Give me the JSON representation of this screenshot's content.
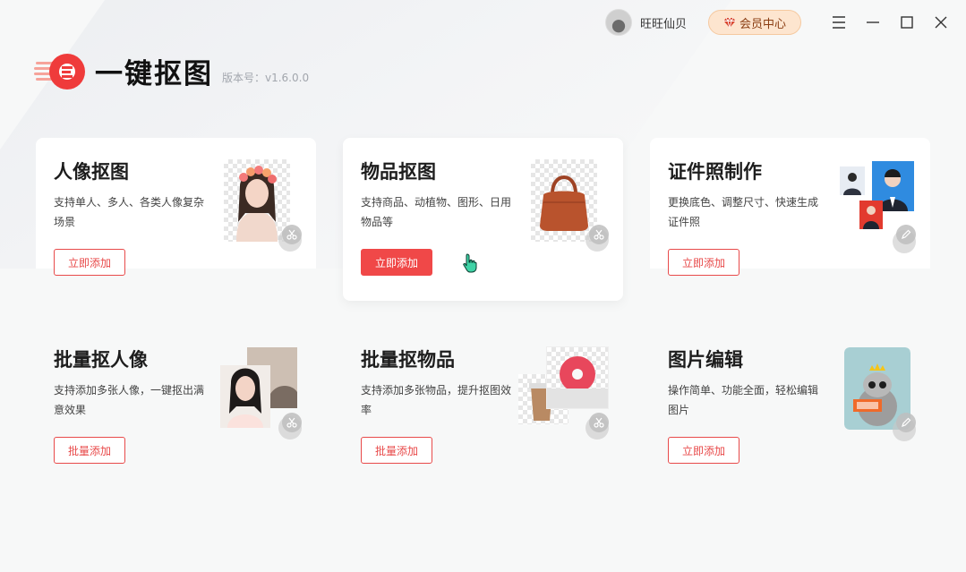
{
  "titlebar": {
    "username": "旺旺仙贝",
    "vip_label": "会员中心"
  },
  "app": {
    "name": "一键抠图",
    "version": "版本号：v1.6.0.0"
  },
  "cards": [
    {
      "title": "人像抠图",
      "desc": "支持单人、多人、各类人像复杂场景",
      "button": "立即添加"
    },
    {
      "title": "物品抠图",
      "desc": "支持商品、动植物、图形、日用物品等",
      "button": "立即添加"
    },
    {
      "title": "证件照制作",
      "desc": "更换底色、调整尺寸、快速生成证件照",
      "button": "立即添加"
    },
    {
      "title": "批量抠人像",
      "desc": "支持添加多张人像，一键抠出满意效果",
      "button": "批量添加"
    },
    {
      "title": "批量抠物品",
      "desc": "支持添加多张物品，提升抠图效率",
      "button": "批量添加"
    },
    {
      "title": "图片编辑",
      "desc": "操作简单、功能全面，轻松编辑图片",
      "button": "立即添加"
    }
  ],
  "icons": {
    "menu": "menu-icon",
    "minimize": "minimize-icon",
    "maximize": "maximize-icon",
    "close": "close-icon",
    "scissors": "scissors-icon",
    "pencil": "pencil-icon"
  },
  "colors": {
    "accent": "#f04848",
    "vip_bg": "#fde5cf"
  }
}
